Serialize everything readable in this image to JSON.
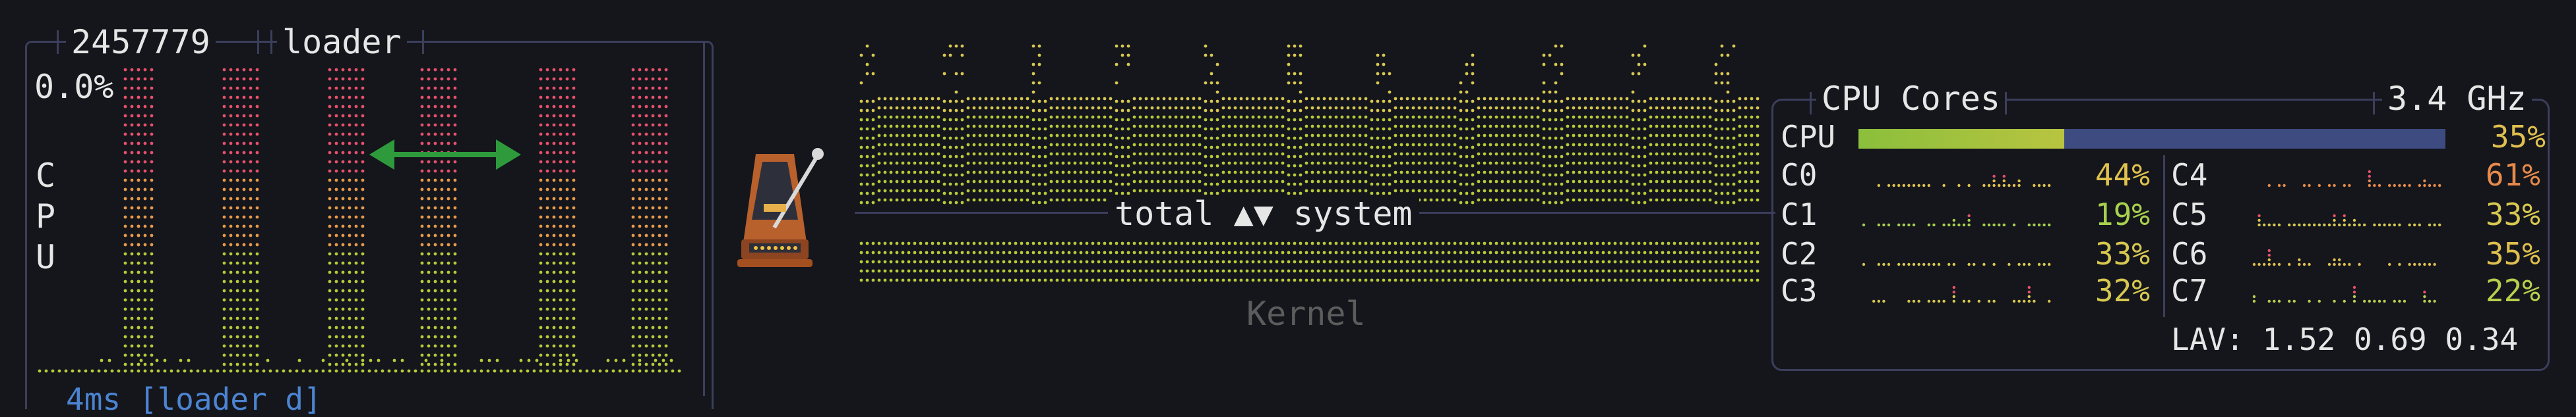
{
  "process": {
    "pid": "2457779",
    "name": "loader",
    "cpu_percent": "0.0%",
    "vertical_label": [
      "C",
      "P",
      "U"
    ],
    "footer_cut_text": "4ms [loader d]"
  },
  "graph": {
    "mid_label": "total ▲▼ system",
    "sub_label": "Kernel"
  },
  "cpu": {
    "title": "CPU Cores",
    "freq": "3.4 GHz",
    "total_label": "CPU",
    "total_pct": "35%",
    "total_pct_value": 35,
    "cores": [
      {
        "name": "C0",
        "pct": "44%",
        "color": "#e0c14e"
      },
      {
        "name": "C1",
        "pct": "19%",
        "color": "#a8d04e"
      },
      {
        "name": "C2",
        "pct": "33%",
        "color": "#d8c850"
      },
      {
        "name": "C3",
        "pct": "32%",
        "color": "#d8c850"
      },
      {
        "name": "C4",
        "pct": "61%",
        "color": "#e88a4a"
      },
      {
        "name": "C5",
        "pct": "33%",
        "color": "#d8c850"
      },
      {
        "name": "C6",
        "pct": "35%",
        "color": "#dfbf4e"
      },
      {
        "name": "C7",
        "pct": "22%",
        "color": "#b8d04e"
      }
    ],
    "load_average": "LAV: 1.52 0.69 0.34"
  },
  "colors": {
    "border": "#3b3f5c",
    "arrow": "#2e9a3c",
    "dot_top": "#e8506a",
    "dot_bottom": "#b9c93a"
  },
  "icons": {
    "metronome": "metronome-icon",
    "resize_arrow": "horizontal-double-arrow-icon"
  }
}
